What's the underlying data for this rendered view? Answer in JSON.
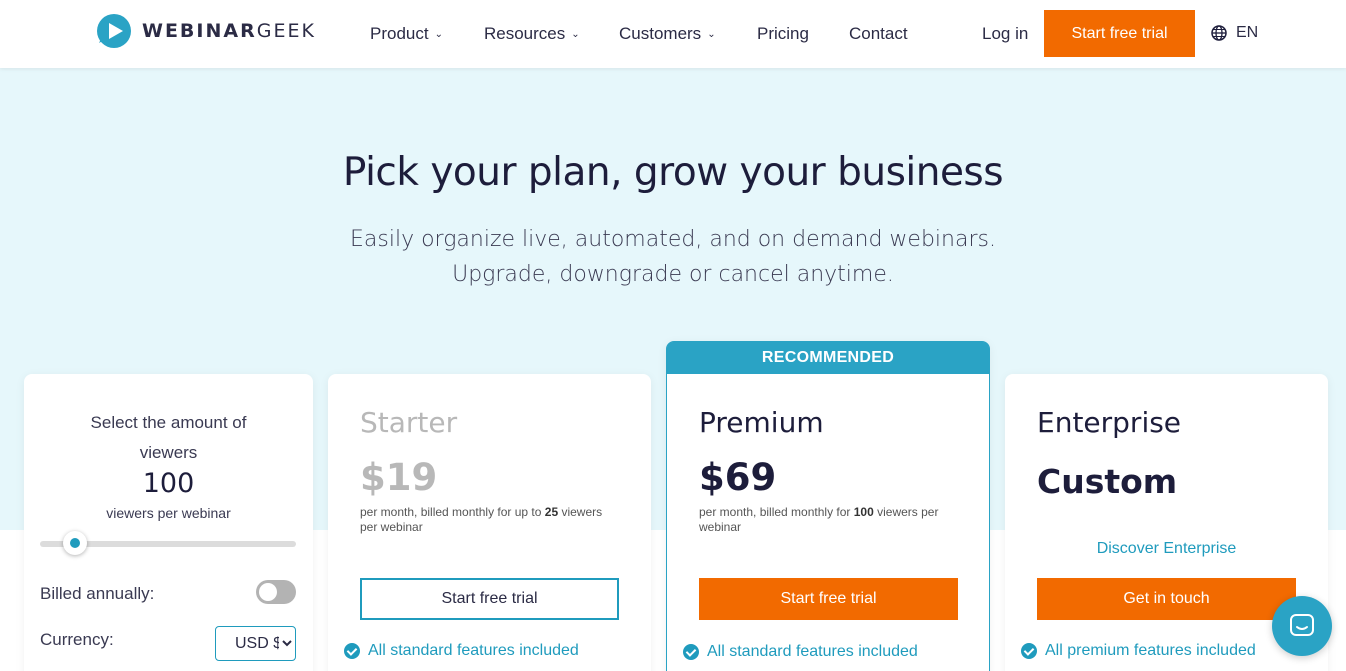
{
  "header": {
    "logo_text_bold": "WEBINAR",
    "logo_text_light": "GEEK",
    "nav": [
      {
        "label": "Product",
        "has_dropdown": true
      },
      {
        "label": "Resources",
        "has_dropdown": true
      },
      {
        "label": "Customers",
        "has_dropdown": true
      },
      {
        "label": "Pricing",
        "has_dropdown": false
      },
      {
        "label": "Contact",
        "has_dropdown": false
      }
    ],
    "login_label": "Log in",
    "cta_label": "Start free trial",
    "language": "EN",
    "caret": "⌄"
  },
  "hero": {
    "title": "Pick your plan, grow your business",
    "subtitle_line1": "Easily organize live, automated, and on demand webinars.",
    "subtitle_line2": "Upgrade, downgrade or cancel anytime."
  },
  "selector": {
    "label_line1": "Select the amount of",
    "label_line2": "viewers",
    "viewer_count": "100",
    "unit_label": "viewers per webinar",
    "slider_fraction": 0.1,
    "billed_label": "Billed annually:",
    "billed_annually": false,
    "currency_label": "Currency:",
    "currency_value": "USD $"
  },
  "plans": {
    "starter": {
      "name": "Starter",
      "price": "$19",
      "desc_prefix": "per month, billed monthly for up to ",
      "desc_bold": "25",
      "desc_suffix": " viewers per webinar",
      "button": "Start free trial",
      "feature": "All standard features included"
    },
    "premium": {
      "badge": "RECOMMENDED",
      "name": "Premium",
      "price": "$69",
      "desc_prefix": "per month, billed monthly for ",
      "desc_bold": "100",
      "desc_suffix": " viewers per webinar",
      "button": "Start free trial",
      "feature": "All standard features included"
    },
    "enterprise": {
      "name": "Enterprise",
      "price": "Custom",
      "link": "Discover Enterprise",
      "button": "Get in touch",
      "feature": "All premium features included"
    }
  },
  "colors": {
    "accent_orange": "#f26a00",
    "accent_teal": "#2aa3c5",
    "hero_bg": "#e6f7fb"
  },
  "icons": {
    "logo": "play-bubble-icon",
    "language": "globe-icon",
    "feature": "check-circle-icon",
    "chat": "chat-icon"
  }
}
